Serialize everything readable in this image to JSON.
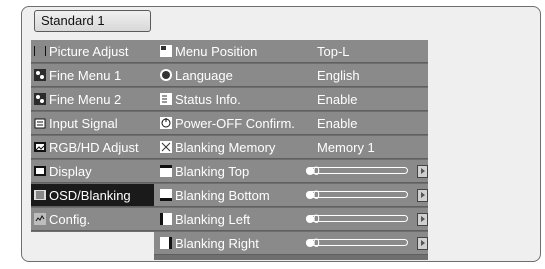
{
  "header": {
    "preset_label": "Standard 1"
  },
  "menu": [
    {
      "label": "Picture Adjust",
      "icon": "picture-adjust-icon"
    },
    {
      "label": "Fine Menu 1",
      "icon": "fine-menu-icon"
    },
    {
      "label": "Fine Menu 2",
      "icon": "fine-menu-icon"
    },
    {
      "label": "Input Signal",
      "icon": "input-signal-icon"
    },
    {
      "label": "RGB/HD Adjust",
      "icon": "rgb-hd-adjust-icon"
    },
    {
      "label": "Display",
      "icon": "display-icon"
    },
    {
      "label": "OSD/Blanking",
      "icon": "osd-blanking-icon",
      "selected": true
    },
    {
      "label": "Config.",
      "icon": "config-icon"
    }
  ],
  "settings": [
    {
      "label": "Menu Position",
      "value": "Top-L",
      "icon": "menu-position-icon"
    },
    {
      "label": "Language",
      "value": "English",
      "icon": "language-icon"
    },
    {
      "label": "Status Info.",
      "value": "Enable",
      "icon": "status-info-icon"
    },
    {
      "label": "Power-OFF Confirm.",
      "value": "Enable",
      "icon": "power-icon"
    },
    {
      "label": "Blanking Memory",
      "value": "Memory 1",
      "icon": "blanking-memory-icon"
    },
    {
      "label": "Blanking Top",
      "value": "0",
      "level": 0,
      "icon": "blanking-top-icon"
    },
    {
      "label": "Blanking Bottom",
      "value": "0",
      "level": 0,
      "icon": "blanking-bottom-icon"
    },
    {
      "label": "Blanking Left",
      "value": "0",
      "level": 0,
      "icon": "blanking-left-icon"
    },
    {
      "label": "Blanking Right",
      "value": "0",
      "level": 0,
      "icon": "blanking-right-icon"
    }
  ],
  "colors": {
    "panel_bg": "#efefef",
    "item_bg": "#8a8a8a",
    "selected_bg": "#1a1a1a",
    "text": "#ffffff"
  }
}
